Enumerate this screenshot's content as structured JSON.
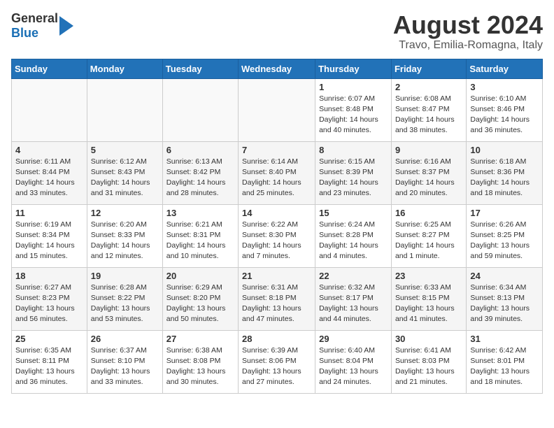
{
  "header": {
    "logo_general": "General",
    "logo_blue": "Blue",
    "month_year": "August 2024",
    "location": "Travo, Emilia-Romagna, Italy"
  },
  "days_of_week": [
    "Sunday",
    "Monday",
    "Tuesday",
    "Wednesday",
    "Thursday",
    "Friday",
    "Saturday"
  ],
  "weeks": [
    [
      {
        "day": "",
        "info": ""
      },
      {
        "day": "",
        "info": ""
      },
      {
        "day": "",
        "info": ""
      },
      {
        "day": "",
        "info": ""
      },
      {
        "day": "1",
        "info": "Sunrise: 6:07 AM\nSunset: 8:48 PM\nDaylight: 14 hours and 40 minutes."
      },
      {
        "day": "2",
        "info": "Sunrise: 6:08 AM\nSunset: 8:47 PM\nDaylight: 14 hours and 38 minutes."
      },
      {
        "day": "3",
        "info": "Sunrise: 6:10 AM\nSunset: 8:46 PM\nDaylight: 14 hours and 36 minutes."
      }
    ],
    [
      {
        "day": "4",
        "info": "Sunrise: 6:11 AM\nSunset: 8:44 PM\nDaylight: 14 hours and 33 minutes."
      },
      {
        "day": "5",
        "info": "Sunrise: 6:12 AM\nSunset: 8:43 PM\nDaylight: 14 hours and 31 minutes."
      },
      {
        "day": "6",
        "info": "Sunrise: 6:13 AM\nSunset: 8:42 PM\nDaylight: 14 hours and 28 minutes."
      },
      {
        "day": "7",
        "info": "Sunrise: 6:14 AM\nSunset: 8:40 PM\nDaylight: 14 hours and 25 minutes."
      },
      {
        "day": "8",
        "info": "Sunrise: 6:15 AM\nSunset: 8:39 PM\nDaylight: 14 hours and 23 minutes."
      },
      {
        "day": "9",
        "info": "Sunrise: 6:16 AM\nSunset: 8:37 PM\nDaylight: 14 hours and 20 minutes."
      },
      {
        "day": "10",
        "info": "Sunrise: 6:18 AM\nSunset: 8:36 PM\nDaylight: 14 hours and 18 minutes."
      }
    ],
    [
      {
        "day": "11",
        "info": "Sunrise: 6:19 AM\nSunset: 8:34 PM\nDaylight: 14 hours and 15 minutes."
      },
      {
        "day": "12",
        "info": "Sunrise: 6:20 AM\nSunset: 8:33 PM\nDaylight: 14 hours and 12 minutes."
      },
      {
        "day": "13",
        "info": "Sunrise: 6:21 AM\nSunset: 8:31 PM\nDaylight: 14 hours and 10 minutes."
      },
      {
        "day": "14",
        "info": "Sunrise: 6:22 AM\nSunset: 8:30 PM\nDaylight: 14 hours and 7 minutes."
      },
      {
        "day": "15",
        "info": "Sunrise: 6:24 AM\nSunset: 8:28 PM\nDaylight: 14 hours and 4 minutes."
      },
      {
        "day": "16",
        "info": "Sunrise: 6:25 AM\nSunset: 8:27 PM\nDaylight: 14 hours and 1 minute."
      },
      {
        "day": "17",
        "info": "Sunrise: 6:26 AM\nSunset: 8:25 PM\nDaylight: 13 hours and 59 minutes."
      }
    ],
    [
      {
        "day": "18",
        "info": "Sunrise: 6:27 AM\nSunset: 8:23 PM\nDaylight: 13 hours and 56 minutes."
      },
      {
        "day": "19",
        "info": "Sunrise: 6:28 AM\nSunset: 8:22 PM\nDaylight: 13 hours and 53 minutes."
      },
      {
        "day": "20",
        "info": "Sunrise: 6:29 AM\nSunset: 8:20 PM\nDaylight: 13 hours and 50 minutes."
      },
      {
        "day": "21",
        "info": "Sunrise: 6:31 AM\nSunset: 8:18 PM\nDaylight: 13 hours and 47 minutes."
      },
      {
        "day": "22",
        "info": "Sunrise: 6:32 AM\nSunset: 8:17 PM\nDaylight: 13 hours and 44 minutes."
      },
      {
        "day": "23",
        "info": "Sunrise: 6:33 AM\nSunset: 8:15 PM\nDaylight: 13 hours and 41 minutes."
      },
      {
        "day": "24",
        "info": "Sunrise: 6:34 AM\nSunset: 8:13 PM\nDaylight: 13 hours and 39 minutes."
      }
    ],
    [
      {
        "day": "25",
        "info": "Sunrise: 6:35 AM\nSunset: 8:11 PM\nDaylight: 13 hours and 36 minutes."
      },
      {
        "day": "26",
        "info": "Sunrise: 6:37 AM\nSunset: 8:10 PM\nDaylight: 13 hours and 33 minutes."
      },
      {
        "day": "27",
        "info": "Sunrise: 6:38 AM\nSunset: 8:08 PM\nDaylight: 13 hours and 30 minutes."
      },
      {
        "day": "28",
        "info": "Sunrise: 6:39 AM\nSunset: 8:06 PM\nDaylight: 13 hours and 27 minutes."
      },
      {
        "day": "29",
        "info": "Sunrise: 6:40 AM\nSunset: 8:04 PM\nDaylight: 13 hours and 24 minutes."
      },
      {
        "day": "30",
        "info": "Sunrise: 6:41 AM\nSunset: 8:03 PM\nDaylight: 13 hours and 21 minutes."
      },
      {
        "day": "31",
        "info": "Sunrise: 6:42 AM\nSunset: 8:01 PM\nDaylight: 13 hours and 18 minutes."
      }
    ]
  ]
}
